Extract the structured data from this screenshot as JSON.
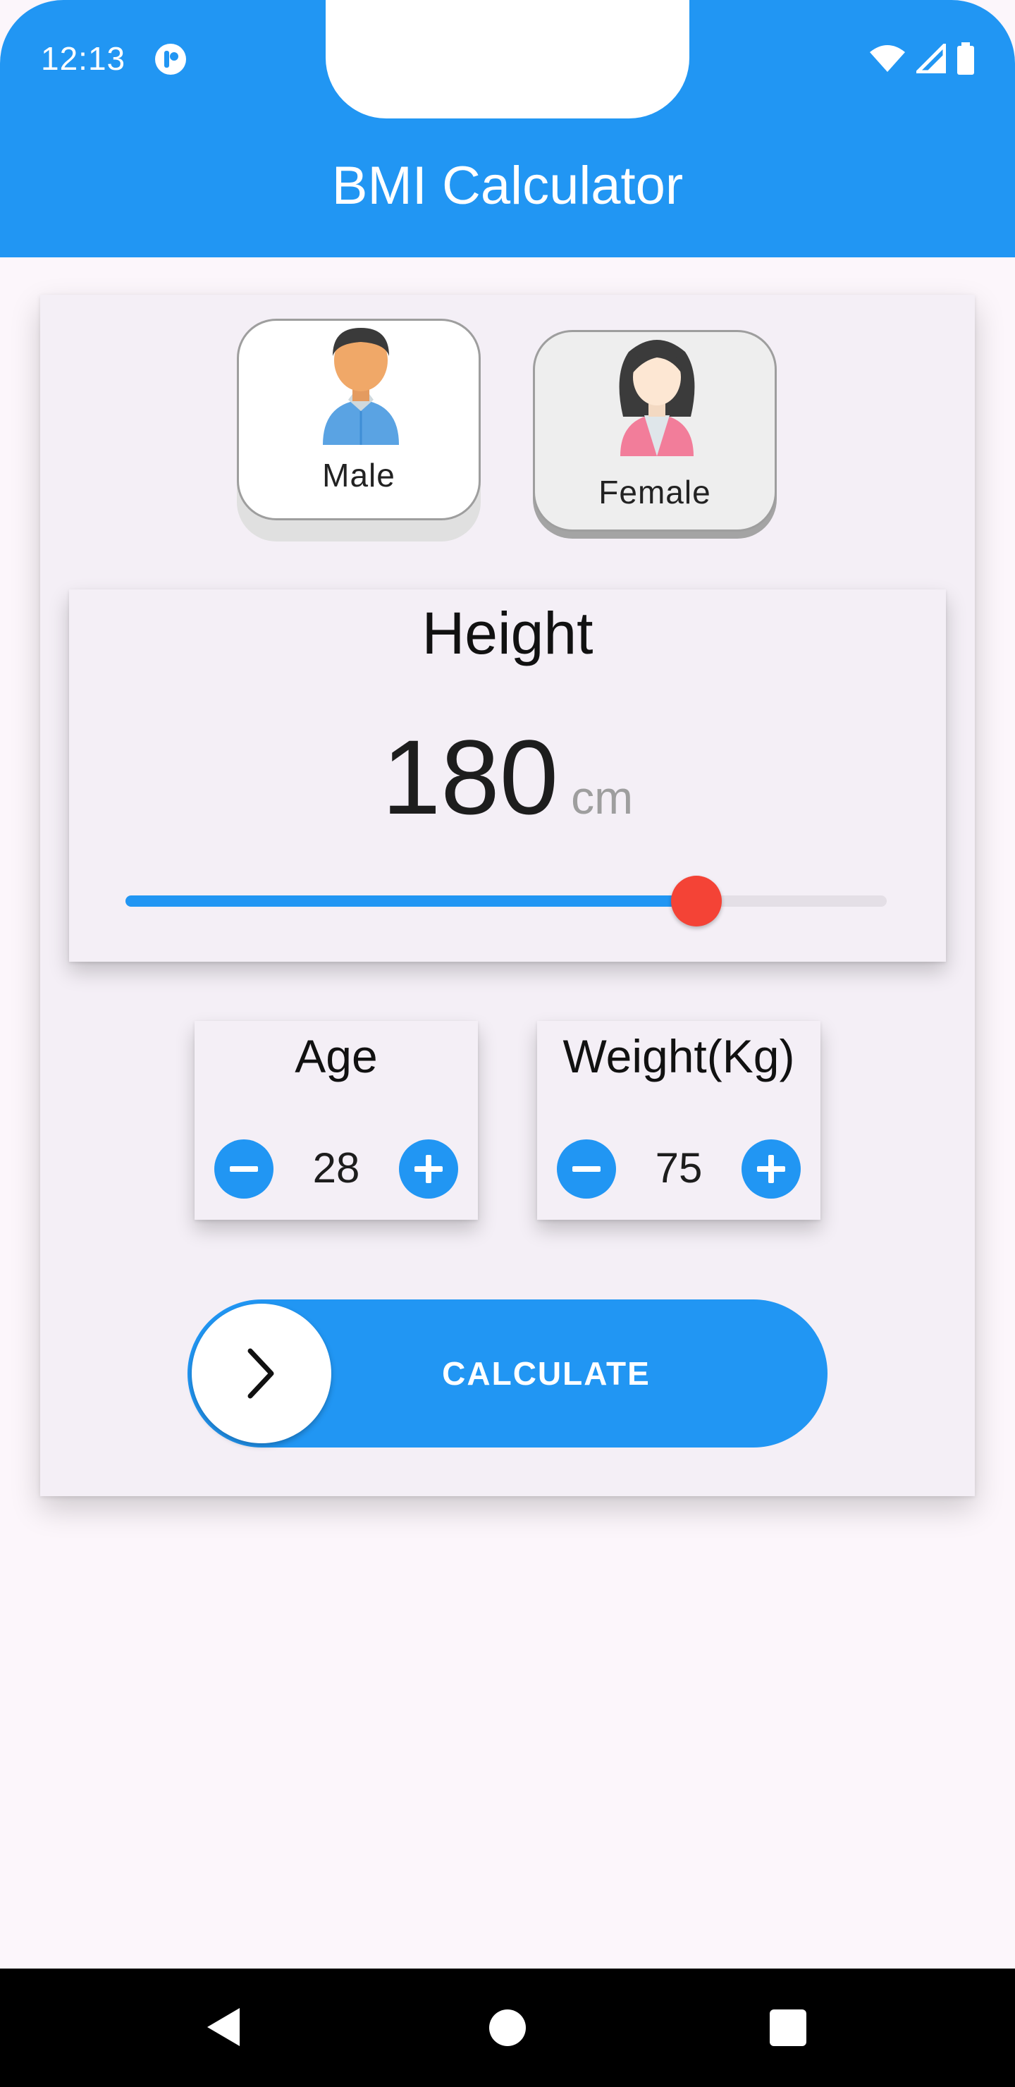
{
  "status_bar": {
    "time": "12:13"
  },
  "app_bar": {
    "title": "BMI Calculator"
  },
  "gender": {
    "male_label": "Male",
    "female_label": "Female",
    "selected": "male"
  },
  "height": {
    "title": "Height",
    "value": "180",
    "unit": "cm",
    "slider_fraction": 0.75
  },
  "age": {
    "title": "Age",
    "value": "28"
  },
  "weight": {
    "title": "Weight(Kg)",
    "value": "75"
  },
  "calculate": {
    "label": "CALCULATE"
  },
  "colors": {
    "primary": "#2196f3",
    "thumb": "#f44336",
    "background": "#fcf6fb",
    "card": "#f4eff6"
  },
  "icons": [
    "minus-icon",
    "plus-icon",
    "chevron-right-icon",
    "back-icon",
    "home-icon",
    "recents-icon",
    "wifi-icon",
    "signal-icon",
    "battery-icon"
  ]
}
